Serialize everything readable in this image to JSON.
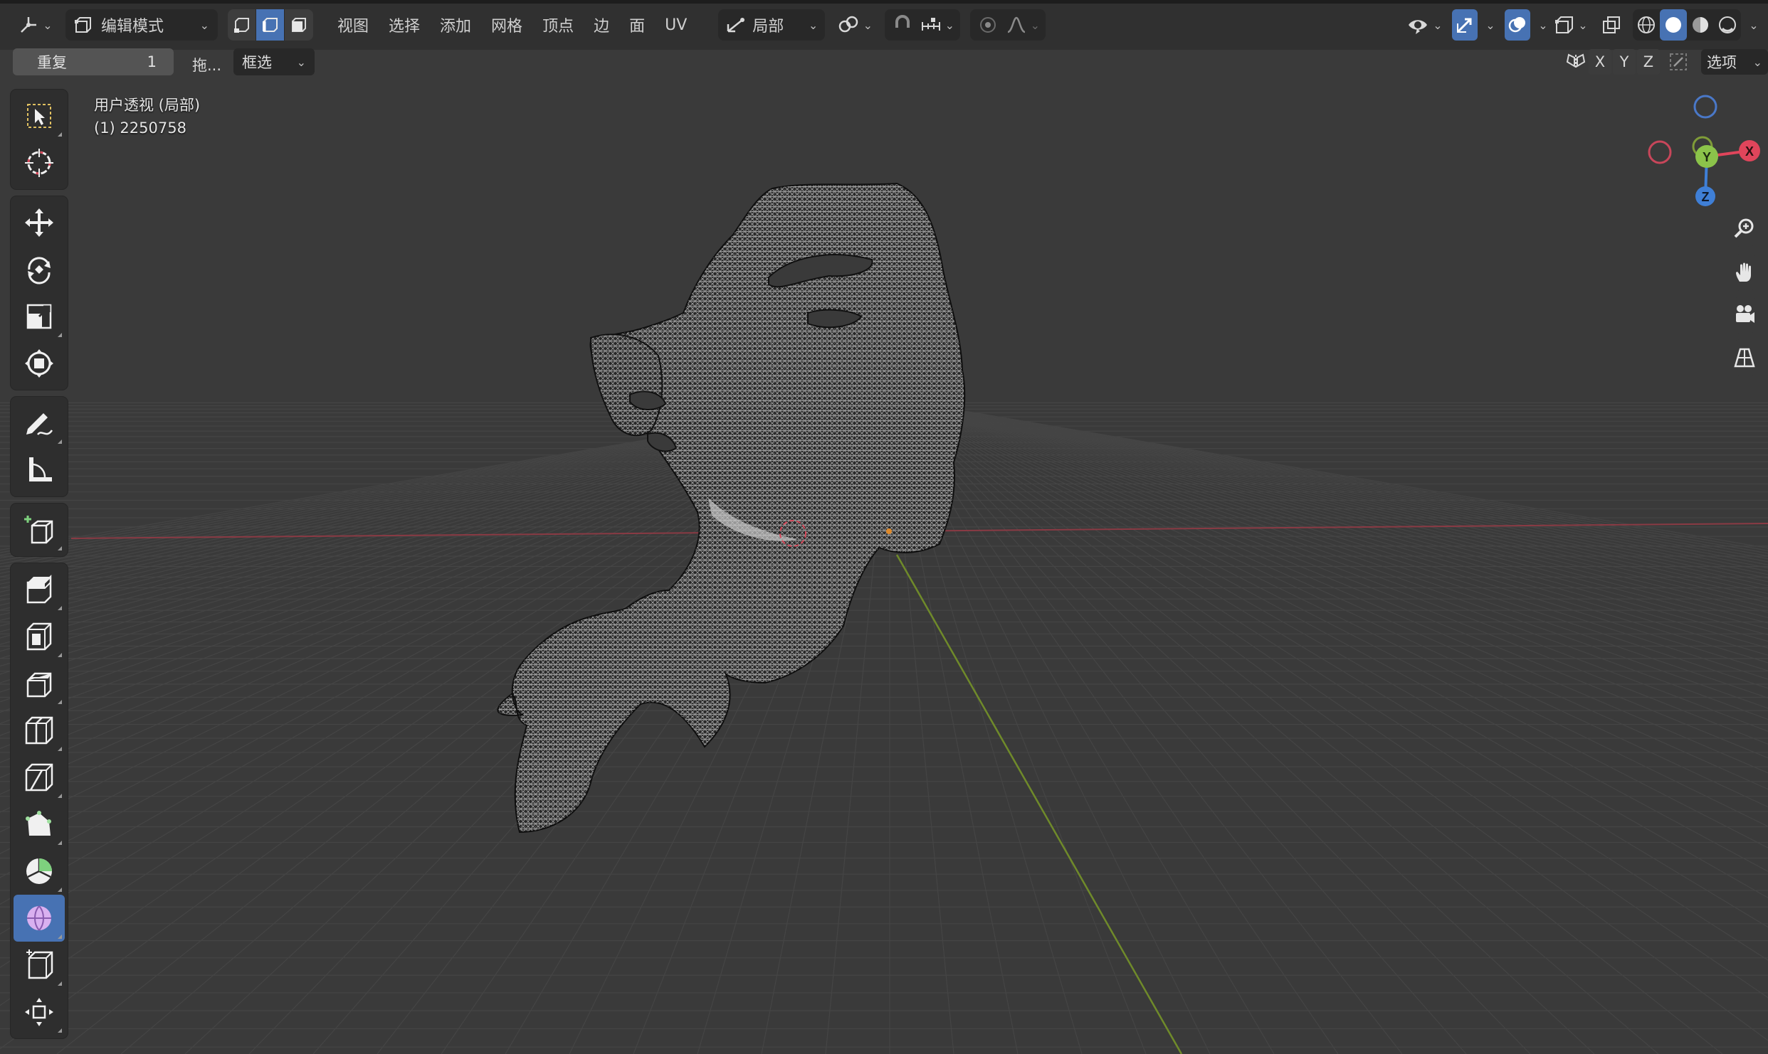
{
  "header": {
    "mode_label": "编辑模式",
    "menus": [
      "视图",
      "选择",
      "添加",
      "网格",
      "顶点",
      "边",
      "面",
      "UV"
    ],
    "pivot_label": "局部"
  },
  "tool_settings": {
    "repeat_label": "重复",
    "repeat_value": "1",
    "drag_label": "拖...",
    "select_mode_label": "框选",
    "axis_x": "X",
    "axis_y": "Y",
    "axis_z": "Z",
    "options_label": "选项"
  },
  "viewport": {
    "view_name": "用户透视 (局部)",
    "object_info": "(1) 2250758"
  },
  "gizmo": {
    "x_label": "X",
    "y_label": "Y",
    "z_label": "Z",
    "x_color": "#e0455b",
    "y_color": "#8bc34a",
    "z_color": "#3f7fd6"
  },
  "toolbar": {
    "active_tool": "spin-tool",
    "accent": "#4772b3",
    "tools": [
      "select-box",
      "cursor",
      "move",
      "rotate",
      "scale",
      "transform",
      "annotate",
      "measure",
      "add-cube",
      "extrude",
      "inset",
      "bevel",
      "loop-cut",
      "knife",
      "poly-build",
      "spin",
      "smooth",
      "edge-slide",
      "shrink-fatten"
    ]
  },
  "navigation": [
    "zoom-icon",
    "hand-pan-icon",
    "camera-icon",
    "grid-view-icon"
  ]
}
